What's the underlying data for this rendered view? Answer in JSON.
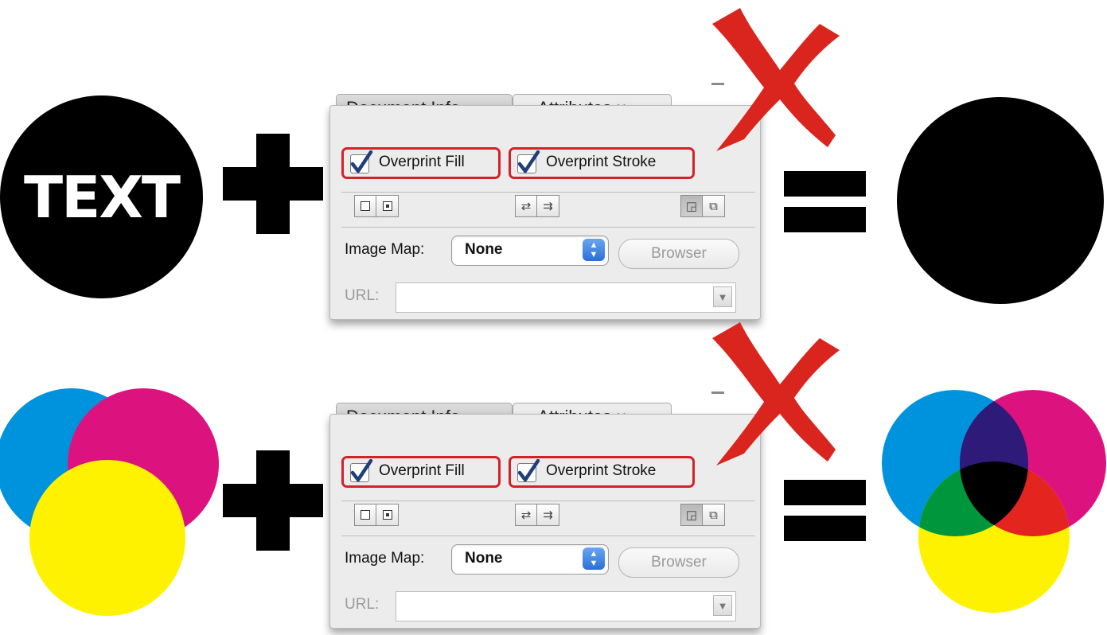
{
  "left_top": {
    "circle_text": "TEXT"
  },
  "panels": [
    {
      "tabs": {
        "document_info": "Document Info",
        "attributes": "Attributes",
        "attributes_close": "×"
      },
      "overprint_fill": {
        "label": "Overprint Fill",
        "checked": true
      },
      "overprint_stroke": {
        "label": "Overprint Stroke",
        "checked": true
      },
      "image_map": {
        "label": "Image Map:",
        "value": "None"
      },
      "browser_button": "Browser",
      "url": {
        "label": "URL:",
        "value": ""
      }
    },
    {
      "tabs": {
        "document_info": "Document Info",
        "attributes": "Attributes",
        "attributes_close": "×"
      },
      "overprint_fill": {
        "label": "Overprint Fill",
        "checked": true
      },
      "overprint_stroke": {
        "label": "Overprint Stroke",
        "checked": true
      },
      "image_map": {
        "label": "Image Map:",
        "value": "None"
      },
      "browser_button": "Browser",
      "url": {
        "label": "URL:",
        "value": ""
      }
    }
  ],
  "colors": {
    "cyan": "#0093dd",
    "magenta": "#dc137f",
    "yellow": "#fff200",
    "highlight_red": "#d2232a",
    "x_mark_red": "#d9251d",
    "black": "#000000",
    "overlap_cyan_magenta": "#2e1a78",
    "overlap_cyan_yellow": "#00963c",
    "overlap_magenta_yellow": "#e3241f"
  },
  "icons": [
    "plus-icon",
    "equals-icon",
    "x-mark-icon",
    "checkbox-icon",
    "stepper-arrows-icon",
    "dropdown-arrow-icon"
  ]
}
